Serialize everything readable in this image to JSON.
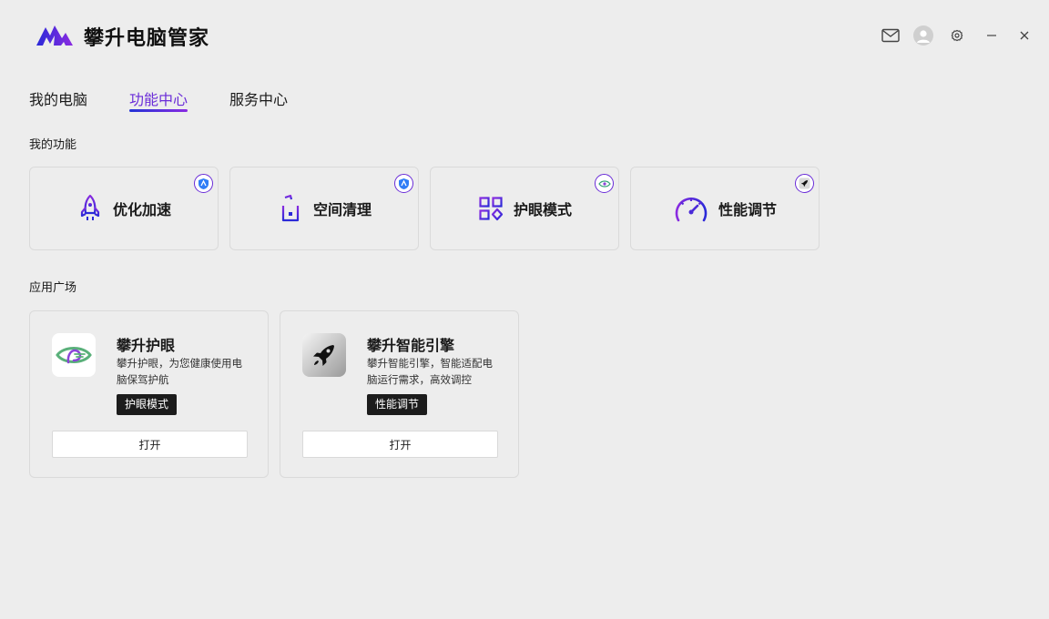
{
  "app": {
    "title": "攀升电脑管家"
  },
  "tabs": [
    {
      "label": "我的电脑",
      "active": false
    },
    {
      "label": "功能中心",
      "active": true
    },
    {
      "label": "服务中心",
      "active": false
    }
  ],
  "sections": {
    "my_features": "我的功能",
    "app_store": "应用广场"
  },
  "features": [
    {
      "label": "优化加速",
      "icon": "rocket-icon",
      "badge": "shield-badge-icon"
    },
    {
      "label": "空间清理",
      "icon": "trash-bin-icon",
      "badge": "shield-badge-icon"
    },
    {
      "label": "护眼模式",
      "icon": "grid-apps-icon",
      "badge": "eye-badge-icon"
    },
    {
      "label": "性能调节",
      "icon": "speedometer-icon",
      "badge": "rocket-badge-icon"
    }
  ],
  "apps": [
    {
      "name": "攀升护眼",
      "desc": "攀升护眼，为您健康使用电脑保驾护航",
      "tag": "护眼模式",
      "button": "打开",
      "icon": "eye-protection-app-icon"
    },
    {
      "name": "攀升智能引擎",
      "desc": "攀升智能引擎，智能适配电脑运行需求，高效调控",
      "tag": "性能调节",
      "button": "打开",
      "icon": "rocket-engine-app-icon"
    }
  ],
  "colors": {
    "accent": "#6a2cd8",
    "accent_blue": "#2233d6",
    "background": "#ededed",
    "tag_bg": "#1c1c1c"
  }
}
